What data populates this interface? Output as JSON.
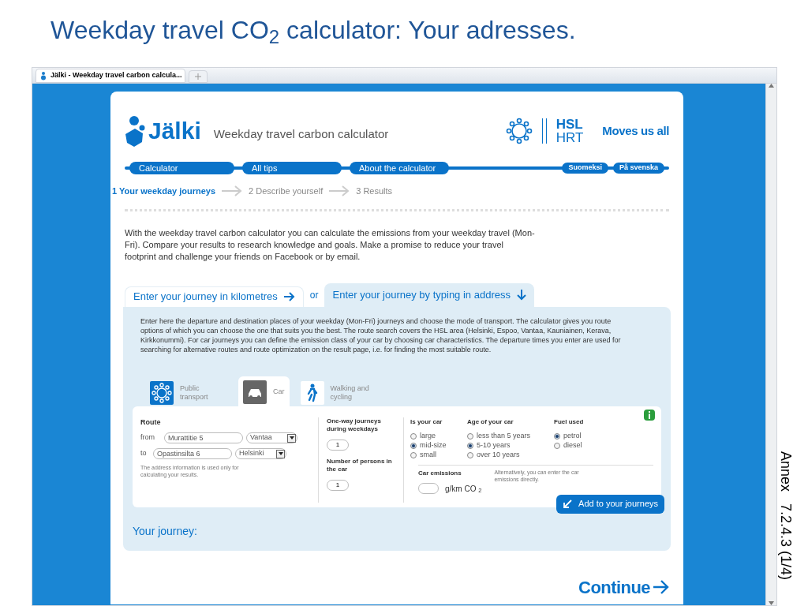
{
  "slide_title": "Weekday travel CO$_{2}$ calculator:  Your adresses.",
  "side_note": "Annex   7.2.4.3 (1/4)",
  "browser": {
    "tab_title": "Jälki - Weekday travel carbon calcula..."
  },
  "header": {
    "logo": "Jälki",
    "subtitle": "Weekday travel carbon calculator",
    "partner_top": "HSL",
    "partner_bottom": "HRT",
    "slogan": "Moves us all"
  },
  "nav": [
    {
      "label": "Calculator"
    },
    {
      "label": "All tips"
    },
    {
      "label": "About the calculator"
    }
  ],
  "languages": [
    "Suomeksi",
    "På svenska"
  ],
  "steps": [
    {
      "label": "1 Your weekday journeys",
      "selected": true
    },
    {
      "label": "2 Describe yourself",
      "selected": false
    },
    {
      "label": "3 Results",
      "selected": false
    }
  ],
  "intro": "With the weekday travel carbon calculator you can calculate the emissions from your weekday travel (Mon-Fri). Compare your results to research knowledge and goals. Make a promise to reduce your travel footprint and challenge your friends on Facebook or by email.",
  "entry_tabs": [
    {
      "label": "Enter your journey in kilometres",
      "kind": "right",
      "selected": false
    },
    {
      "label": "Enter your journey by typing in address",
      "kind": "down",
      "selected": true
    }
  ],
  "entry_or": "or",
  "description": "Enter here the departure and destination places of your weekday (Mon-Fri) journeys and choose the mode of transport. The calculator gives you route options of which you can choose the one that suits you the best. The route search covers the HSL area (Helsinki, Espoo, Vantaa, Kauniainen, Kerava, Kirkkonummi). For car journeys you can define the emission class of your car by choosing car characteristics. The departure times you enter are used for searching for alternative routes and route optimization on the result page, i.e. for finding the most suitable route.",
  "modes": [
    {
      "label": "Public transport",
      "kind": "transit",
      "selected": false
    },
    {
      "label": "Car",
      "kind": "car",
      "selected": true
    },
    {
      "label": "Walking and cycling",
      "kind": "walk",
      "selected": false
    }
  ],
  "route": {
    "title": "Route",
    "rows": [
      {
        "label": "from",
        "address": "Murattitie 5",
        "city": "Vantaa"
      },
      {
        "label": "to",
        "address": "Opastinsilta 6",
        "city": "Helsinki"
      }
    ],
    "note": "The address information is used only for calculating your results."
  },
  "journeys": {
    "label": "One-way journeys during weekdays",
    "value": "1"
  },
  "persons": {
    "label": "Number of persons in the car",
    "value": "1"
  },
  "option_groups": [
    {
      "title": "Is your car",
      "options": [
        {
          "label": "large",
          "selected": false
        },
        {
          "label": "mid-size",
          "selected": true
        },
        {
          "label": "small",
          "selected": false
        }
      ]
    },
    {
      "title": "Age of your car",
      "options": [
        {
          "label": "less than 5 years",
          "selected": false
        },
        {
          "label": "5-10 years",
          "selected": true
        },
        {
          "label": "over 10 years",
          "selected": false
        }
      ]
    },
    {
      "title": "Fuel used",
      "options": [
        {
          "label": "petrol",
          "selected": true
        },
        {
          "label": "diesel",
          "selected": false
        }
      ]
    }
  ],
  "emissions": {
    "label": "Car emissions",
    "unit": "g/km CO $_{2}$",
    "note": "Alternatively, you can enter the car emissions directly."
  },
  "add_button": "Add to your journeys",
  "your_journey": "Your journey:",
  "continue": "Continue"
}
